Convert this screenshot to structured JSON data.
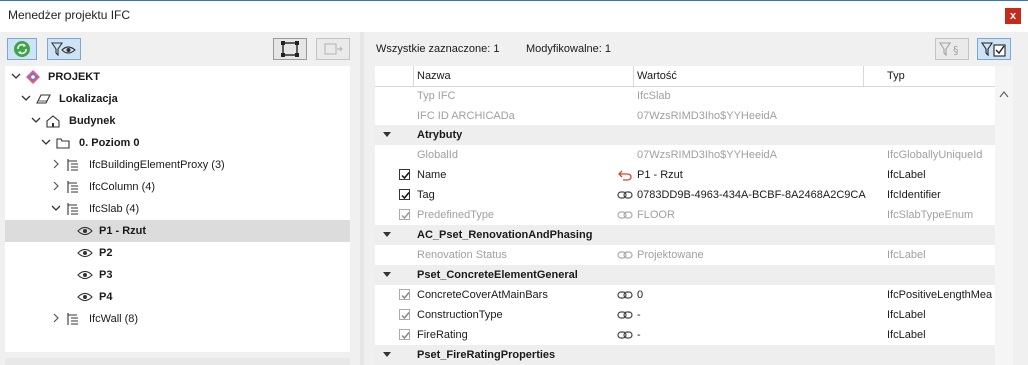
{
  "window": {
    "title": "Menedżer projektu IFC",
    "close_label": "x"
  },
  "summary": {
    "all_selected": "Wszystkie zaznaczone: 1",
    "modifiable": "Modyfikowalne: 1"
  },
  "tree": [
    {
      "label": "PROJEKT",
      "bold": true
    },
    {
      "label": "Lokalizacja",
      "bold": true
    },
    {
      "label": "Budynek",
      "bold": true
    },
    {
      "label": "0. Poziom 0",
      "bold": true
    },
    {
      "label": "IfcBuildingElementProxy (3)",
      "bold": false
    },
    {
      "label": "IfcColumn (4)",
      "bold": false
    },
    {
      "label": "IfcSlab (4)",
      "bold": false
    },
    {
      "label": "P1 - Rzut",
      "bold": true,
      "selected": true
    },
    {
      "label": "P2",
      "bold": true
    },
    {
      "label": "P3",
      "bold": true
    },
    {
      "label": "P4",
      "bold": true
    },
    {
      "label": "IfcWall (8)",
      "bold": false
    }
  ],
  "grid": {
    "headers": {
      "name": "Nazwa",
      "value": "Wartość",
      "type": "Typ"
    },
    "rows": [
      {
        "name": "Typ IFC",
        "value": "IfcSlab",
        "type": "",
        "kind": "info"
      },
      {
        "name": "IFC ID ARCHICADa",
        "value": "07WzsRIMD3Iho$YYHeeidA",
        "type": "",
        "kind": "info"
      },
      {
        "name": "Atrybuty",
        "kind": "group"
      },
      {
        "name": "GlobalId",
        "value": "07WzsRIMD3Iho$YYHeeidA",
        "type": "IfcGloballyUniqueId",
        "kind": "info"
      },
      {
        "name": "Name",
        "value": "P1 - Rzut",
        "type": "IfcLabel",
        "kind": "check",
        "icon": "undo-icon"
      },
      {
        "name": "Tag",
        "value": "0783DD9B-4963-434A-BCBF-8A2468A2C9CA",
        "type": "IfcIdentifier",
        "kind": "check",
        "icon": "link-icon"
      },
      {
        "name": "PredefinedType",
        "value": "FLOOR",
        "type": "IfcSlabTypeEnum",
        "kind": "check-grey",
        "icon": "link-icon"
      },
      {
        "name": "AC_Pset_RenovationAndPhasing",
        "kind": "group"
      },
      {
        "name": "Renovation Status",
        "value": "Projektowane",
        "type": "IfcLabel",
        "kind": "info-link",
        "icon": "link-icon"
      },
      {
        "name": "Pset_ConcreteElementGeneral",
        "kind": "group"
      },
      {
        "name": "ConcreteCoverAtMainBars",
        "value": "0",
        "type": "IfcPositiveLengthMea",
        "kind": "check-light",
        "icon": "link-icon"
      },
      {
        "name": "ConstructionType",
        "value": "-",
        "type": "IfcLabel",
        "kind": "check-light",
        "icon": "link-icon"
      },
      {
        "name": "FireRating",
        "value": "-",
        "type": "IfcLabel",
        "kind": "check-light",
        "icon": "link-icon"
      },
      {
        "name": "Pset_FireRatingProperties",
        "kind": "group"
      }
    ]
  },
  "colors": {
    "accent": "#2b78d0",
    "selection": "#dcdcdc",
    "group_bg": "#eeeeee",
    "close": "#c42b1c"
  }
}
